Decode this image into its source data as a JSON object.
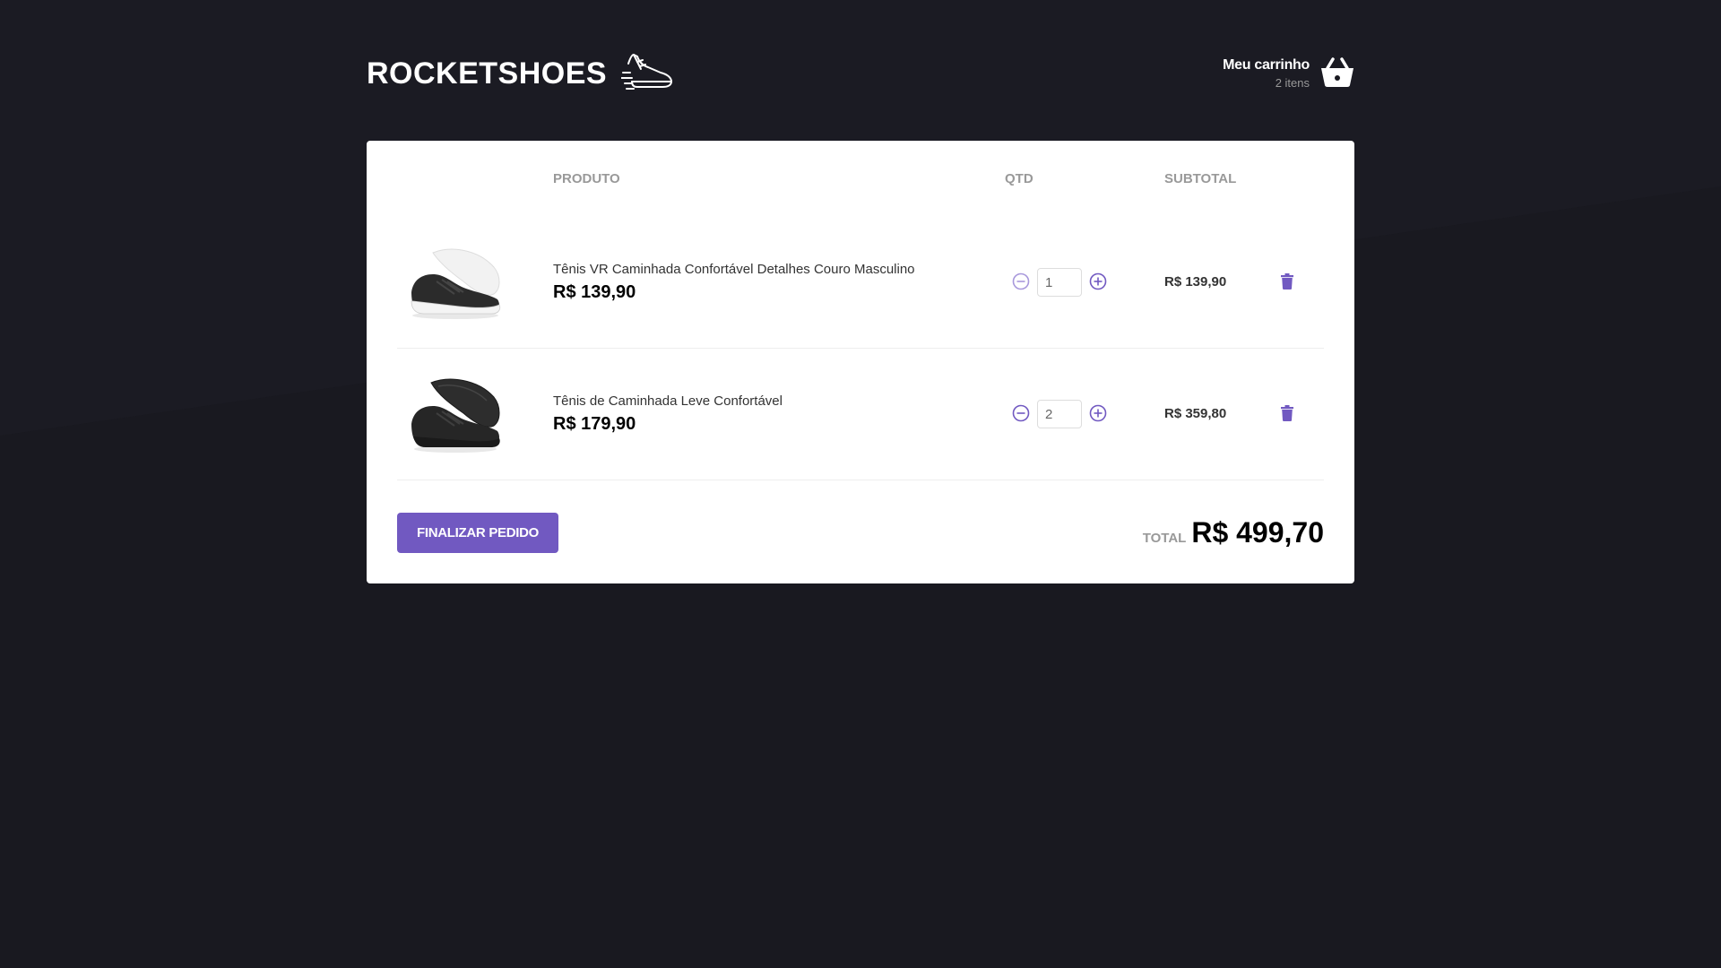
{
  "brand": {
    "name": "ROCKETSHOES",
    "logo_icon": "sneaker-icon"
  },
  "cart_header": {
    "title": "Meu carrinho",
    "count": "2 itens",
    "icon": "basket-icon"
  },
  "table": {
    "headers": [
      "",
      "PRODUTO",
      "QTD",
      "SUBTOTAL",
      ""
    ],
    "items": [
      {
        "title": "Tênis VR Caminhada Confortável Detalhes Couro Masculino",
        "price": "R$ 139,90",
        "quantity": "1",
        "subtotal": "R$ 139,90",
        "image": "sneaker-black-white-sole",
        "decrement_disabled": true
      },
      {
        "title": "Tênis de Caminhada Leve Confortável",
        "price": "R$ 179,90",
        "quantity": "2",
        "subtotal": "R$ 359,80",
        "image": "sneaker-all-black",
        "decrement_disabled": false
      }
    ]
  },
  "footer": {
    "button_label": "Finalizar pedido",
    "total_label": "TOTAL",
    "total_value": "R$ 499,70"
  },
  "colors": {
    "background": "#191920",
    "accent": "#7159c1",
    "card": "#ffffff"
  }
}
